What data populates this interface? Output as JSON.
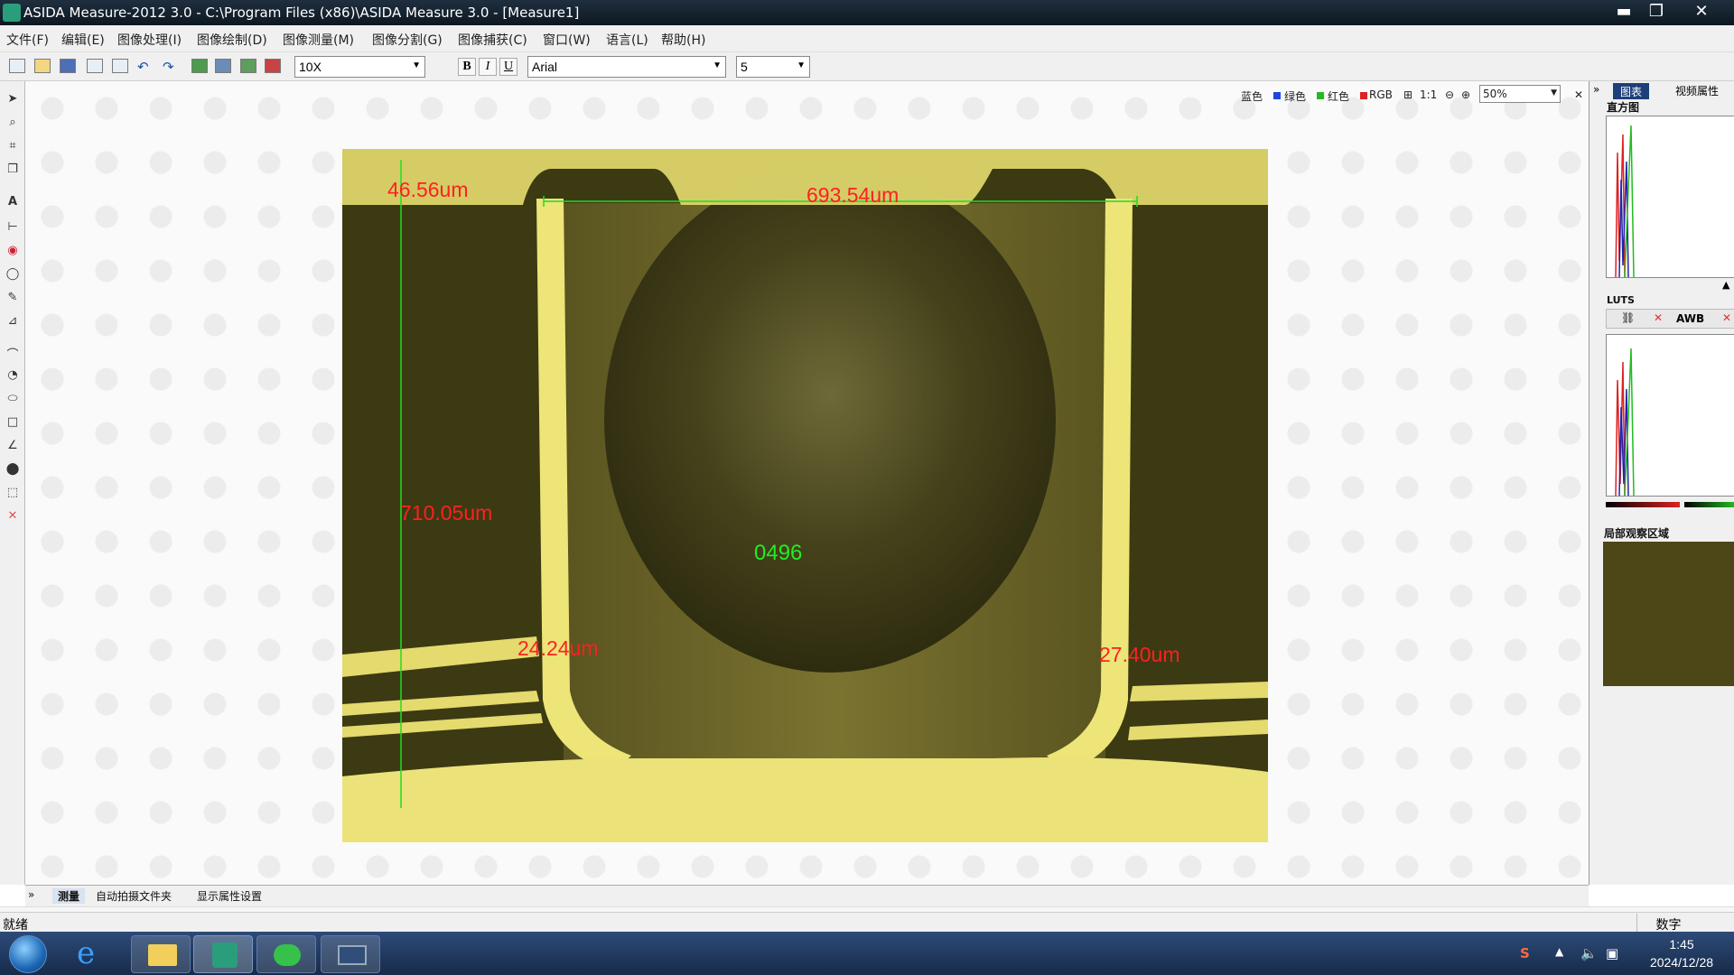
{
  "window": {
    "title": "ASIDA Measure-2012 3.0 - C:\\Program Files (x86)\\ASIDA Measure 3.0 - [Measure1]",
    "minimize": "▬",
    "maximize": "❐",
    "close": "✕"
  },
  "menu": [
    "文件(F)",
    "编辑(E)",
    "图像处理(I)",
    "图像绘制(D)",
    "图像测量(M)",
    "图像分割(G)",
    "图像捕获(C)",
    "窗口(W)",
    "语言(L)",
    "帮助(H)"
  ],
  "toolbar": {
    "magnification": "10X",
    "font": "Arial",
    "font_size": "5",
    "bold": "B",
    "italic": "I",
    "underline": "U"
  },
  "view_toolbar": {
    "blue": "蓝色",
    "green": "绿色",
    "red": "红色",
    "rgb": "RGB",
    "ratio": "1:1",
    "zoom": "50%",
    "close": "✕"
  },
  "measurements": {
    "top_left_thickness": "46.56um",
    "top_width": "693.54um",
    "depth": "710.05um",
    "count": "0496",
    "left_wall": "24.24um",
    "right_wall": "27.40um"
  },
  "right_panel": {
    "collapse": "»",
    "tab_chart": "图表",
    "tab_video": "视频属性",
    "histogram_label": "直方图",
    "luts_label": "LUTS",
    "awb": "AWB",
    "local_view_label": "局部观察区域"
  },
  "bottom_tabs": [
    "测量",
    "自动拍摄文件夹",
    "显示属性设置"
  ],
  "status": {
    "text": "就绪",
    "num": "数字"
  },
  "clock": {
    "time": "1:45",
    "date": "2024/12/28"
  },
  "colors": {
    "measure_text": "#ff2020",
    "measure_line": "#22dd22",
    "copper": "#e8e070",
    "taskbar": "#1d3560"
  }
}
